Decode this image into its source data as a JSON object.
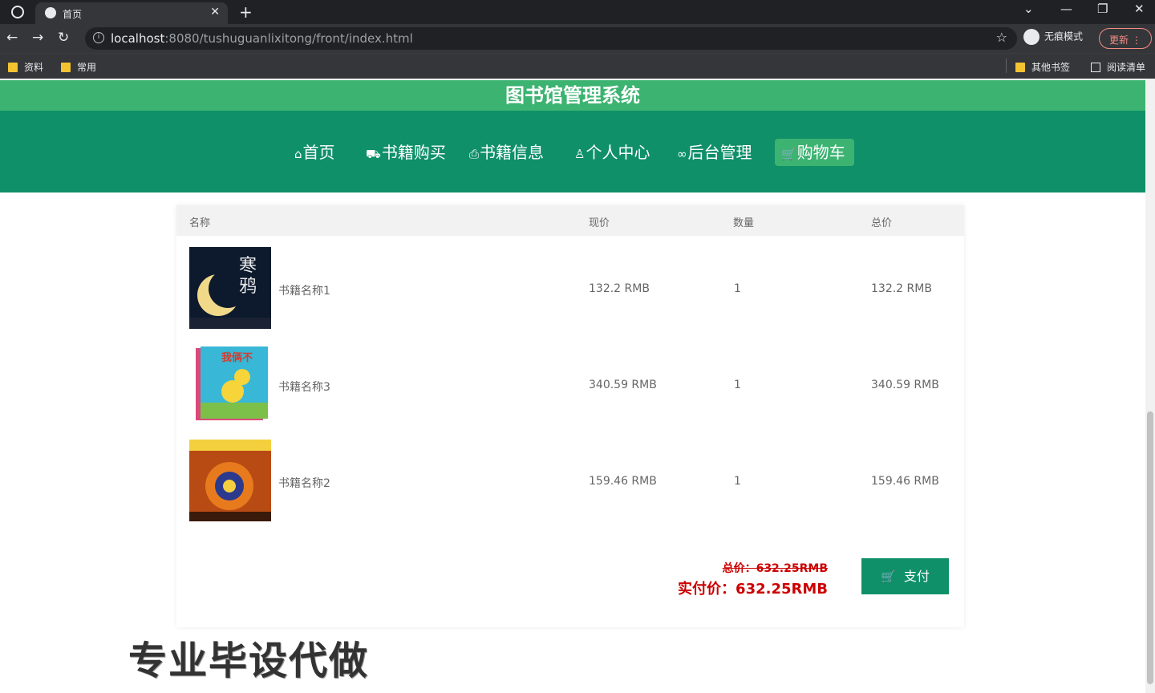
{
  "browser": {
    "tab_title": "首页",
    "url_host": "localhost",
    "url_rest": ":8080/tushuguanlixitong/front/index.html",
    "incognito_label": "无痕模式",
    "update_label": "更新",
    "bookmarks": [
      "资料",
      "常用"
    ],
    "bookmarks_right": [
      "其他书签",
      "阅读清单"
    ]
  },
  "site": {
    "title": "图书馆管理系统",
    "nav": [
      {
        "label": "首页",
        "icon": "home-icon"
      },
      {
        "label": "书籍购买",
        "icon": "bus-icon"
      },
      {
        "label": "书籍信息",
        "icon": "print-icon"
      },
      {
        "label": "个人中心",
        "icon": "user-icon"
      },
      {
        "label": "后台管理",
        "icon": "link-icon"
      },
      {
        "label": "购物车",
        "icon": "cart-icon",
        "active": true
      }
    ]
  },
  "cart": {
    "headers": {
      "name": "名称",
      "price": "现价",
      "quantity": "数量",
      "total": "总价"
    },
    "items": [
      {
        "name": "书籍名称1",
        "price": "132.2 RMB",
        "quantity": "1",
        "total": "132.2 RMB"
      },
      {
        "name": "书籍名称3",
        "price": "340.59 RMB",
        "quantity": "1",
        "total": "340.59 RMB"
      },
      {
        "name": "书籍名称2",
        "price": "159.46 RMB",
        "quantity": "1",
        "total": "159.46 RMB"
      }
    ],
    "total_label": "总价：632.25RMB",
    "actual_label": "实付价：632.25RMB",
    "pay_label": "支付"
  },
  "watermark": "专业毕设代做",
  "colors": {
    "header_green": "#3cb371",
    "nav_green": "#0f9068",
    "price_red": "#cc0000"
  }
}
